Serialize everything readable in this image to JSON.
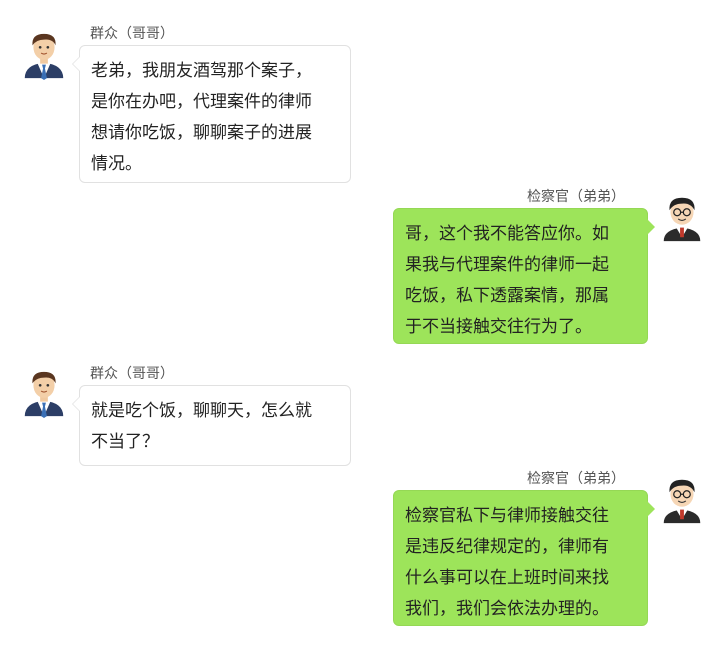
{
  "colors": {
    "right_bubble": "#9de45a",
    "left_bubble": "#ffffff",
    "left_bubble_border": "#e1e1e1",
    "name_text": "#555555"
  },
  "messages": [
    {
      "side": "left",
      "sender": "群众（哥哥）",
      "avatar_icon": "businessman-avatar-icon",
      "lines": [
        "老弟，我朋友酒驾那个案子，",
        "是你在办吧，代理案件的律师",
        "想请你吃饭，聊聊案子的进展",
        "情况。"
      ]
    },
    {
      "side": "right",
      "sender": "检察官（弟弟）",
      "avatar_icon": "prosecutor-avatar-icon",
      "lines": [
        "哥，这个我不能答应你。如",
        "果我与代理案件的律师一起",
        "吃饭，私下透露案情，那属",
        "于不当接触交往行为了。"
      ]
    },
    {
      "side": "left",
      "sender": "群众（哥哥）",
      "avatar_icon": "businessman-avatar-icon",
      "lines": [
        "就是吃个饭，聊聊天，怎么就",
        "不当了？"
      ]
    },
    {
      "side": "right",
      "sender": "检察官（弟弟）",
      "avatar_icon": "prosecutor-avatar-icon",
      "lines": [
        "检察官私下与律师接触交往",
        "是违反纪律规定的，律师有",
        "什么事可以在上班时间来找",
        "我们，我们会依法办理的。"
      ]
    }
  ]
}
